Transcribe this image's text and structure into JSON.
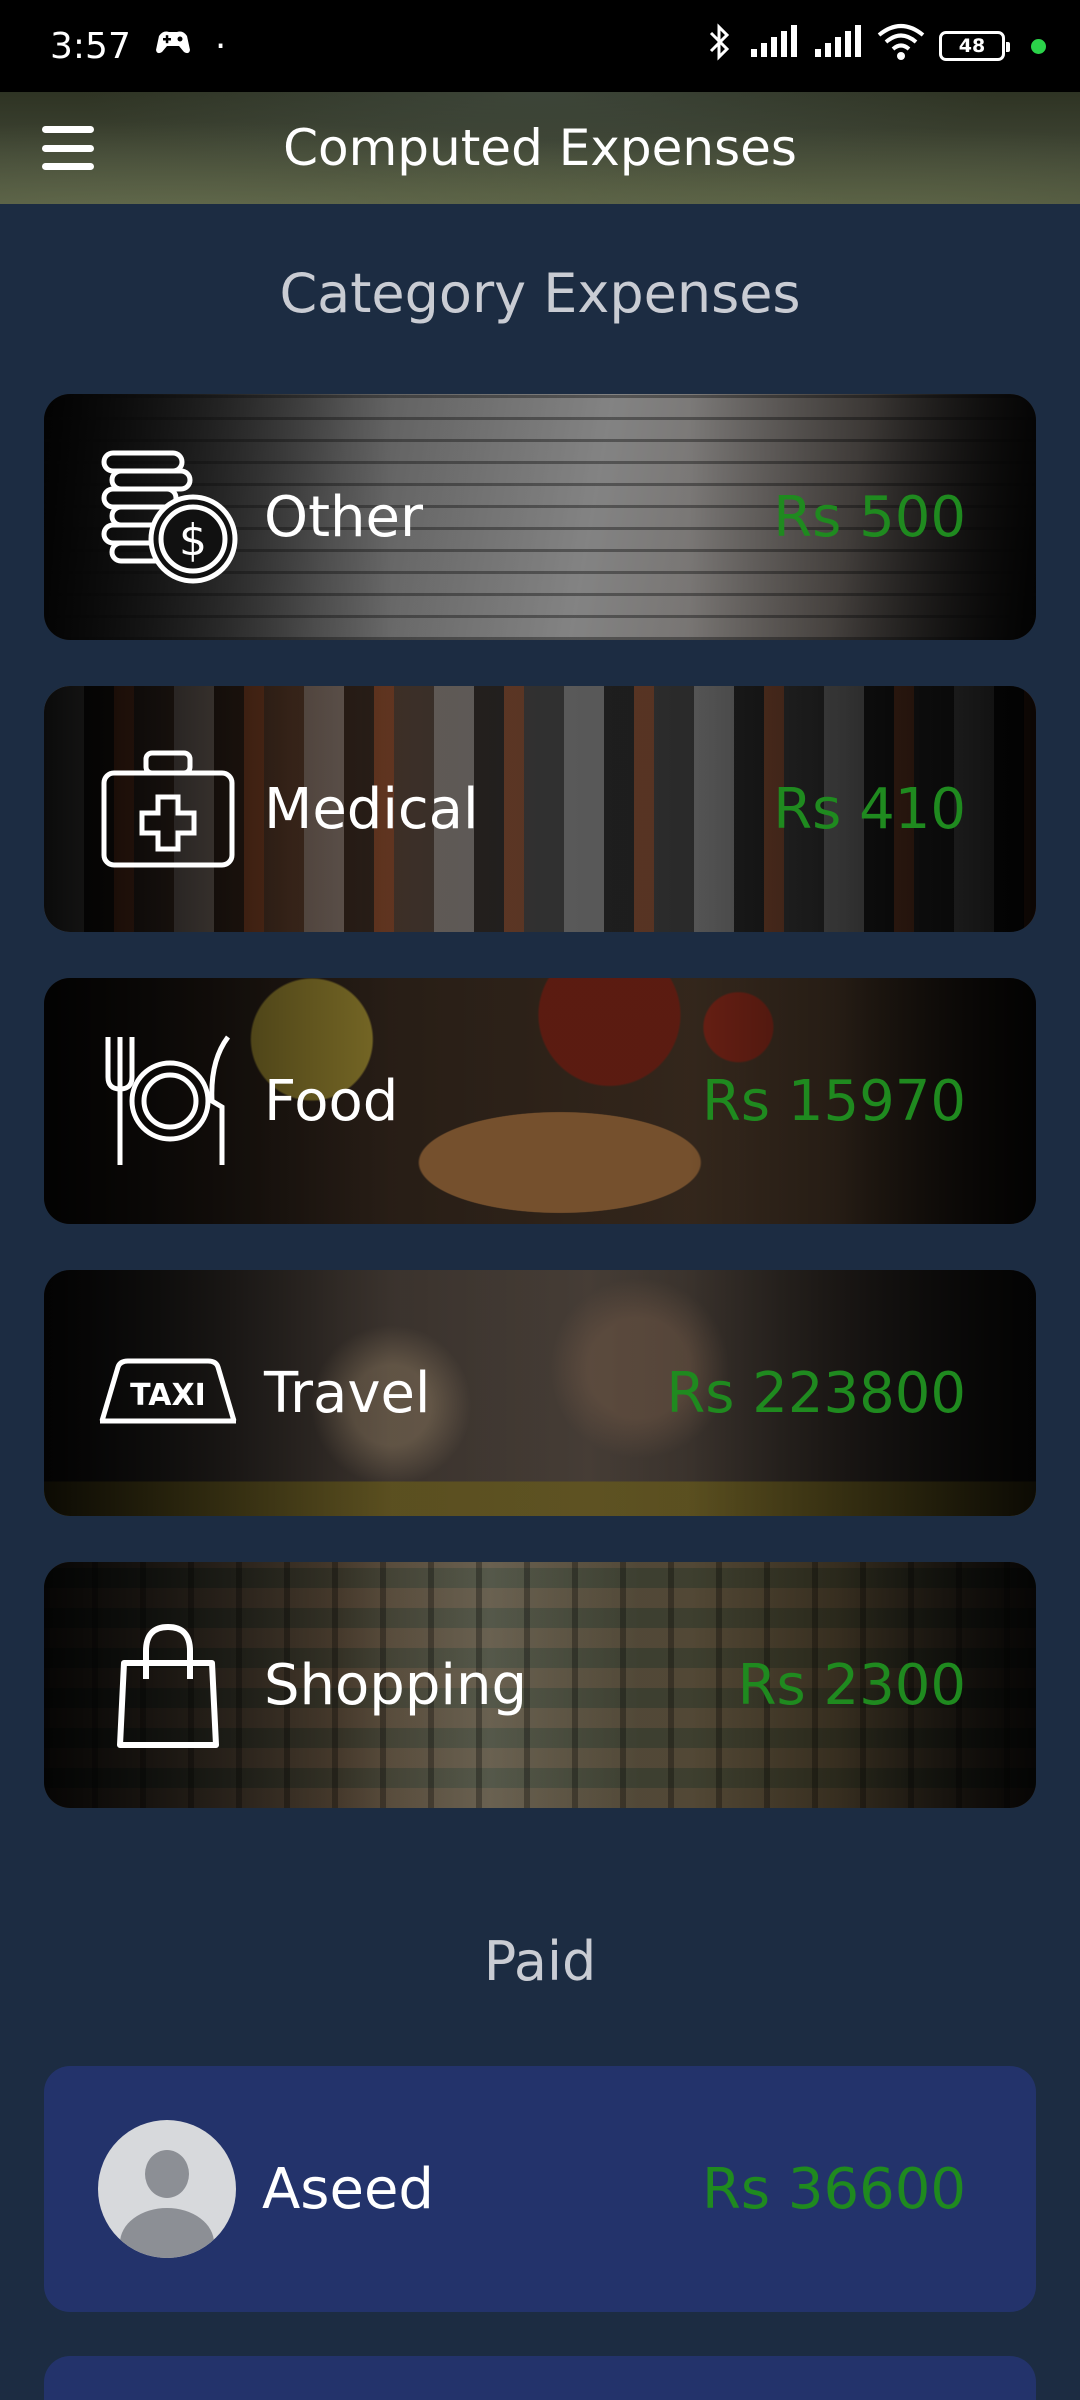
{
  "status_bar": {
    "time": "3:57",
    "dot": "·",
    "battery": "48"
  },
  "app_bar": {
    "title": "Computed Expenses"
  },
  "sections": {
    "categories_title": "Category Expenses",
    "paid_title": "Paid"
  },
  "categories": [
    {
      "label": "Other",
      "amount": "Rs 500",
      "icon": "coins-dollar-icon"
    },
    {
      "label": "Medical",
      "amount": "Rs 410",
      "icon": "first-aid-kit-icon"
    },
    {
      "label": "Food",
      "amount": "Rs 15970",
      "icon": "plate-cutlery-icon"
    },
    {
      "label": "Travel",
      "amount": "Rs 223800",
      "icon": "taxi-sign-icon",
      "icon_text": "TAXI"
    },
    {
      "label": "Shopping",
      "amount": "Rs 2300",
      "icon": "shopping-bag-icon"
    }
  ],
  "paid": [
    {
      "name": "Aseed",
      "amount": "Rs 36600",
      "icon": "avatar-icon"
    }
  ],
  "colors": {
    "background": "#1c2c42",
    "amount_green": "#1f8a1f",
    "paid_card": "#23336b"
  }
}
